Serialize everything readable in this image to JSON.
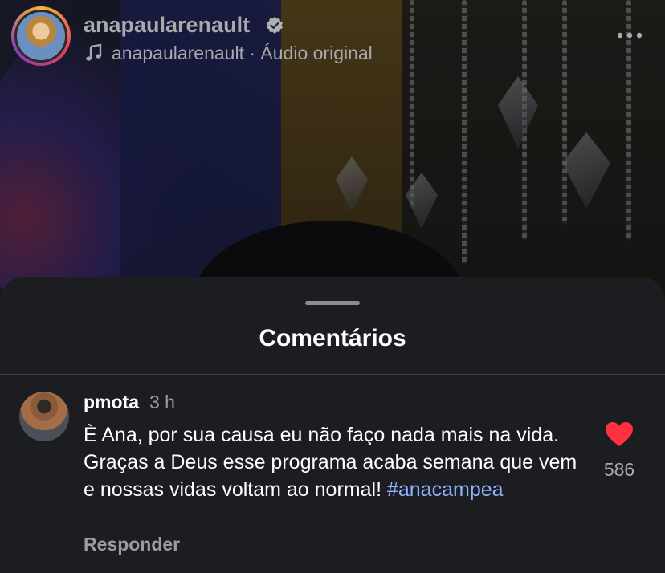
{
  "header": {
    "username": "anapaularenault",
    "audio_line": "anapaularenault · Áudio original"
  },
  "sheet": {
    "title": "Comentários"
  },
  "comment": {
    "user": "pmota",
    "time": "3 h",
    "text_before": "È Ana, por sua causa eu não faço nada mais na vida. Graças a Deus esse programa acaba semana que vem e nossas vidas voltam ao normal! ",
    "hashtag": "#anacampea",
    "likes": "586",
    "reply_label": "Responder"
  },
  "colors": {
    "heart": "#ff3040",
    "hashtag": "#8fb3ff",
    "sheet_bg": "#1c1d20"
  },
  "icons": [
    "verified-icon",
    "music-note-icon",
    "more-icon",
    "heart-icon"
  ]
}
